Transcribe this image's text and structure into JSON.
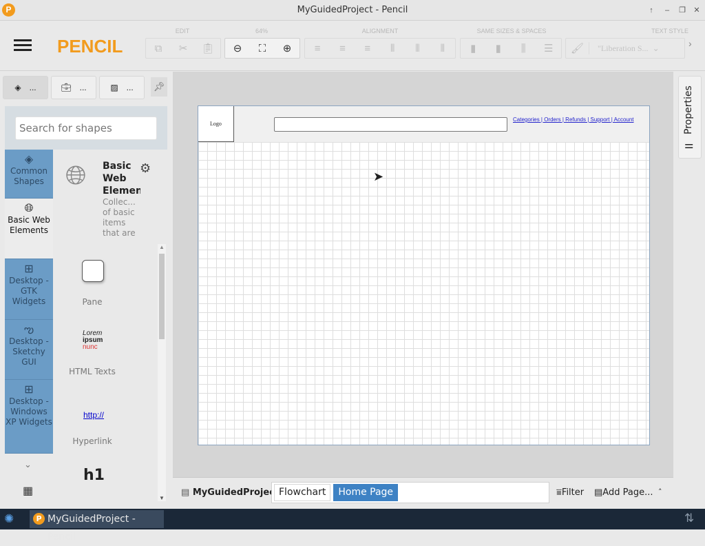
{
  "window": {
    "title": "MyGuidedProject - Pencil"
  },
  "toolbar": {
    "brand": "PENCIL",
    "groups": {
      "edit": "EDIT",
      "zoom": "64%",
      "alignment": "ALIGNMENT",
      "same": "SAME SIZES & SPACES",
      "text": "TEXT STYLE"
    },
    "font_select": "\"Liberation S..."
  },
  "panel": {
    "tabs": [
      "...",
      "...",
      "..."
    ],
    "search_placeholder": "Search for shapes",
    "categories": [
      "Common Shapes",
      "Basic Web Elements",
      "Desktop - GTK Widgets",
      "Desktop - Sketchy GUI",
      "Desktop - Windows XP Widgets"
    ],
    "collection": {
      "title": "Basic Web Elemen",
      "desc": "Collec... of basic items that are"
    },
    "shapes": [
      {
        "name": "Pane"
      },
      {
        "name": "HTML Texts",
        "preview": [
          "Lorem",
          "ipsum",
          "nunc"
        ]
      },
      {
        "name": "Hyperlink",
        "preview": "http://"
      },
      {
        "preview": "h1"
      }
    ]
  },
  "canvas": {
    "logo": "Logo",
    "links": "Categories | Orders | Refunds | Support | Account"
  },
  "right": {
    "properties": "Properties"
  },
  "bottom": {
    "project": "MyGuidedProject",
    "pages": [
      "Flowchart",
      "Home Page"
    ],
    "filter": "Filter",
    "add_page": "Add Page..."
  },
  "taskbar": {
    "task": "MyGuidedProject - Pencil"
  }
}
